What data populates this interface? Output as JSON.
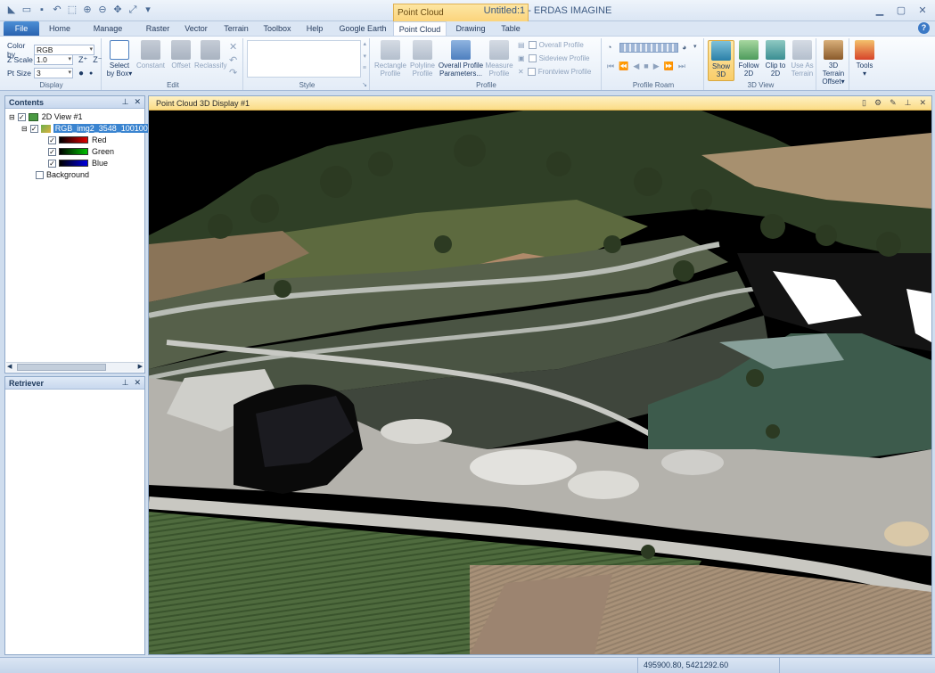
{
  "window": {
    "title": "Untitled:1 - ERDAS IMAGINE",
    "context_tab_group": "Point Cloud"
  },
  "ribbon_tabs": [
    "File",
    "Home",
    "Manage Data",
    "Raster",
    "Vector",
    "Terrain",
    "Toolbox",
    "Help",
    "Google Earth",
    "Point Cloud",
    "Drawing",
    "Table"
  ],
  "display_group": {
    "label": "Display",
    "color_by_label": "Color by",
    "color_by_value": "RGB",
    "z_scale_label": "Z Scale",
    "z_scale_value": "1.0",
    "pt_size_label": "Pt Size",
    "pt_size_value": "3"
  },
  "edit_group": {
    "label": "Edit",
    "select_by_box": "Select by Box",
    "constant": "Constant",
    "offset": "Offset",
    "reclassify": "Reclassify"
  },
  "style_group": {
    "label": "Style"
  },
  "profile_group": {
    "label": "Profile",
    "rectangle_profile": "Rectangle Profile",
    "polyline_profile": "Polyline Profile",
    "overall_profile_parameters": "Overall Profile Parameters...",
    "measure_profile": "Measure Profile",
    "overall_profile": "Overall Profile",
    "sideview_profile": "Sideview Profile",
    "frontview_profile": "Frontview Profile"
  },
  "profile_roam_group": {
    "label": "Profile Roam"
  },
  "view3d_group": {
    "label": "3D View",
    "show_3d": "Show 3D",
    "follow_2d": "Follow 2D",
    "clip_to_2d": "Clip to 2D",
    "use_as_terrain": "Use As Terrain",
    "terrain_offset": "3D Terrain Offset",
    "tools": "Tools"
  },
  "contents_panel": {
    "title": "Contents",
    "view_name": "2D View #1",
    "layer_name": "RGB_img2_3548_10010013",
    "bands": [
      {
        "name": "Red",
        "color": "#cc0000"
      },
      {
        "name": "Green",
        "color": "#00a000"
      },
      {
        "name": "Blue",
        "color": "#0000cc"
      }
    ],
    "background": "Background"
  },
  "retriever_panel": {
    "title": "Retriever"
  },
  "view": {
    "tab_title": "Point Cloud 3D Display #1"
  },
  "status": {
    "coordinates": "495900.80, 5421292.60"
  }
}
